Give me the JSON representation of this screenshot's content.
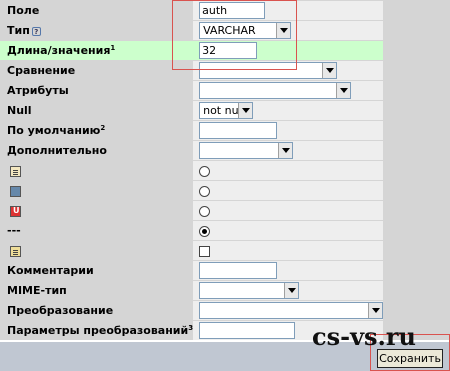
{
  "rows": {
    "field": {
      "label": "Поле",
      "value": "auth"
    },
    "type": {
      "label": "Тип",
      "help": "?",
      "value": "VARCHAR"
    },
    "length": {
      "label": "Длина/значения",
      "sup": "1",
      "value": "32"
    },
    "collation": {
      "label": "Сравнение",
      "value": ""
    },
    "attributes": {
      "label": "Атрибуты",
      "value": ""
    },
    "null": {
      "label": "Null",
      "value": "not null"
    },
    "default": {
      "label": "По умолчанию",
      "sup": "2",
      "value": ""
    },
    "extra": {
      "label": "Дополнительно",
      "value": ""
    },
    "index_none": {
      "label": "---"
    },
    "comments": {
      "label": "Комментарии",
      "value": ""
    },
    "mime": {
      "label": "MIME-тип",
      "value": ""
    },
    "transformation": {
      "label": "Преобразование",
      "value": ""
    },
    "transform_options": {
      "label": "Параметры преобразований",
      "sup": "3",
      "value": ""
    }
  },
  "key_options": {
    "selected": "none",
    "fulltext_checked": false
  },
  "watermark": "cs-vs.ru",
  "save_label": "Сохранить",
  "colors": {
    "highlight": "#ccffcc",
    "label_bg": "#d5d5d5",
    "value_bg": "#eeeeee",
    "annotation": "#d9534f"
  }
}
